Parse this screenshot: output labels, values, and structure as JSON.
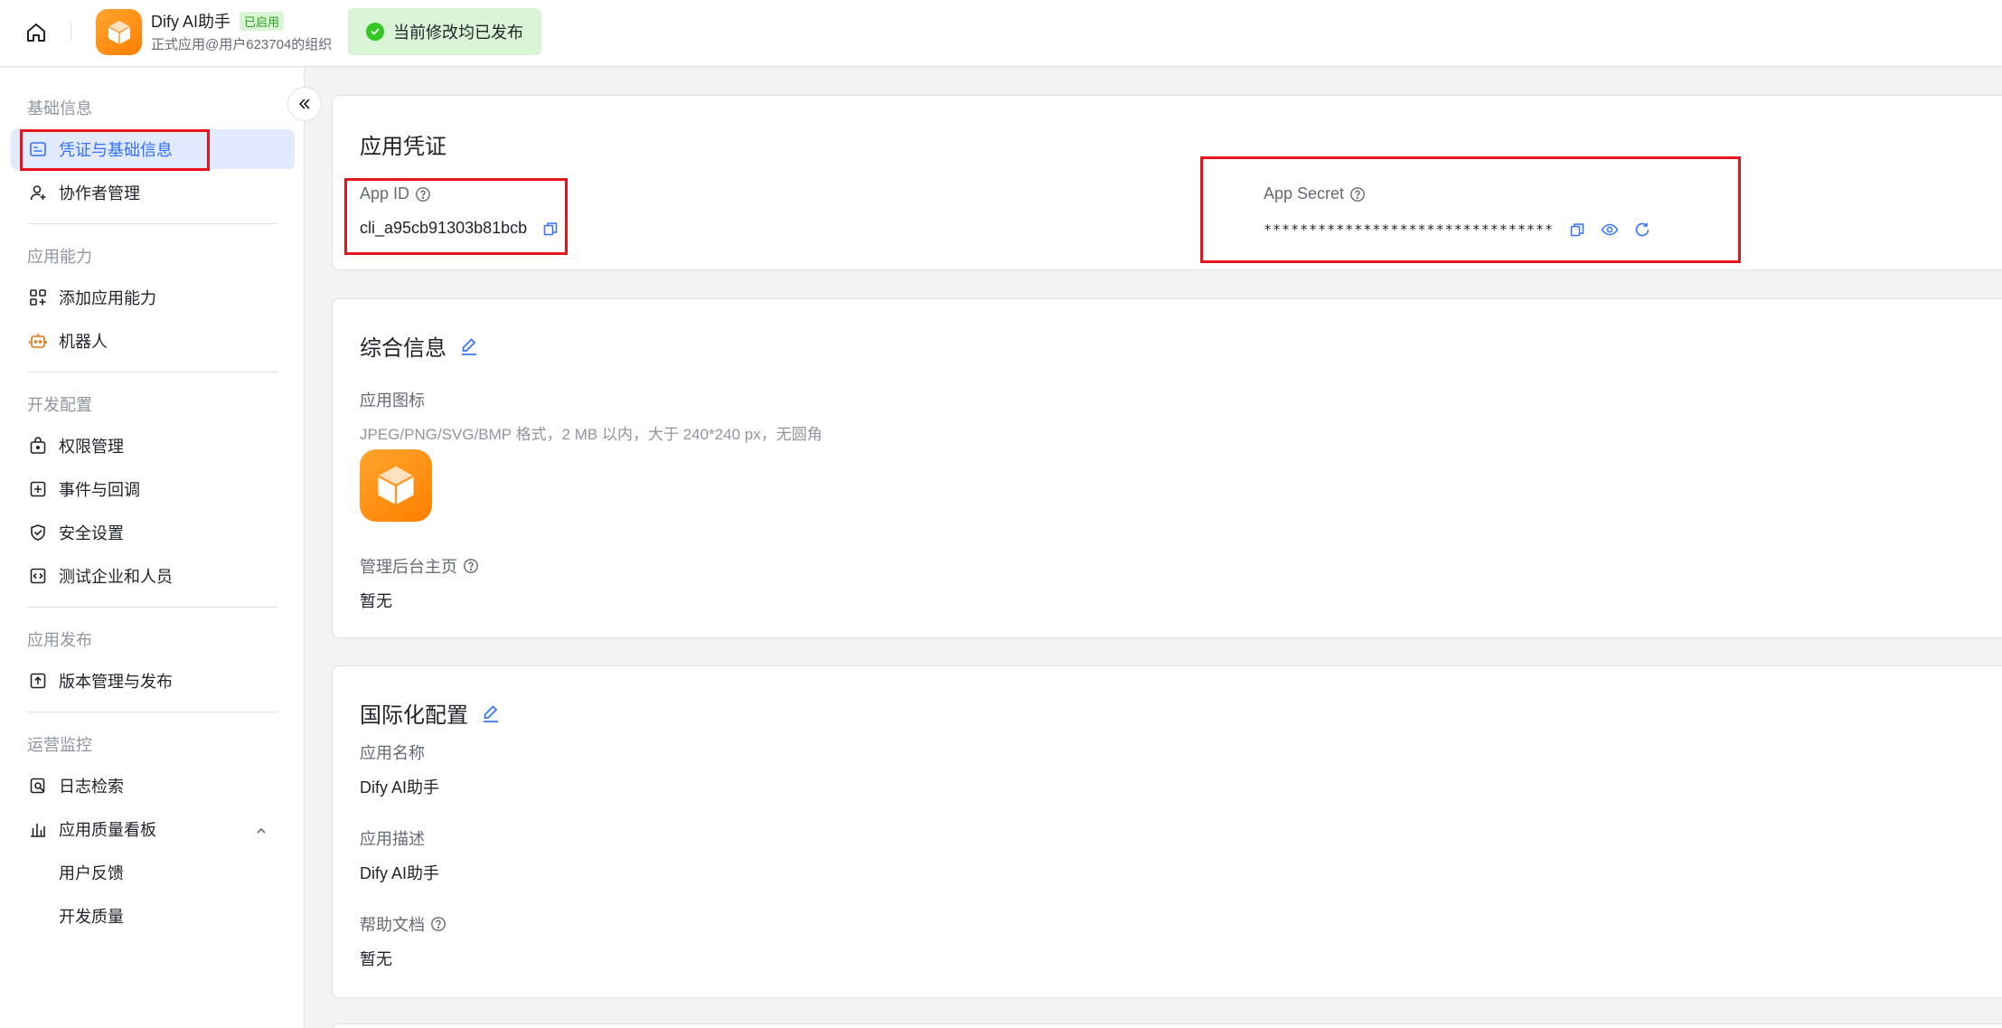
{
  "header": {
    "app_name": "Dify AI助手",
    "status_badge": "已启用",
    "org": "正式应用@用户623704的组织",
    "publish_status": "当前修改均已发布",
    "icons": [
      "home-icon",
      "app-logo-cube-icon",
      "check-circle-icon"
    ]
  },
  "sidebar": {
    "sections": [
      {
        "title": "基础信息",
        "items": [
          {
            "label": "凭证与基础信息",
            "icon": "credential-icon",
            "active": true
          },
          {
            "label": "协作者管理",
            "icon": "user-add-icon"
          }
        ]
      },
      {
        "title": "应用能力",
        "items": [
          {
            "label": "添加应用能力",
            "icon": "apps-add-icon"
          },
          {
            "label": "机器人",
            "icon": "robot-icon"
          }
        ]
      },
      {
        "title": "开发配置",
        "items": [
          {
            "label": "权限管理",
            "icon": "permission-icon"
          },
          {
            "label": "事件与回调",
            "icon": "event-icon"
          },
          {
            "label": "安全设置",
            "icon": "shield-icon"
          },
          {
            "label": "测试企业和人员",
            "icon": "code-icon"
          }
        ]
      },
      {
        "title": "应用发布",
        "items": [
          {
            "label": "版本管理与发布",
            "icon": "upload-icon"
          }
        ]
      },
      {
        "title": "运营监控",
        "items": [
          {
            "label": "日志检索",
            "icon": "log-search-icon"
          },
          {
            "label": "应用质量看板",
            "icon": "bar-chart-icon",
            "expanded": true
          },
          {
            "label": "用户反馈"
          },
          {
            "label": "开发质量"
          }
        ]
      }
    ]
  },
  "credentials": {
    "title": "应用凭证",
    "app_id_label": "App ID",
    "app_id_value": "cli_a95cb91303b81bcb",
    "app_secret_label": "App Secret",
    "app_secret_value": "********************************"
  },
  "general": {
    "title": "综合信息",
    "icon_label": "应用图标",
    "icon_hint": "JPEG/PNG/SVG/BMP 格式，2 MB 以内，大于 240*240 px，无圆角",
    "homepage_label": "管理后台主页",
    "homepage_value": "暂无"
  },
  "i18n": {
    "title": "国际化配置",
    "name_label": "应用名称",
    "name_value": "Dify AI助手",
    "desc_label": "应用描述",
    "desc_value": "Dify AI助手",
    "help_label": "帮助文档",
    "help_value": "暂无"
  },
  "colors": {
    "accent": "#3370ff",
    "active_bg": "#e1eaff",
    "success": "#34c724",
    "logo_orange": "#ff8c1a",
    "annotation_red": "#e8141b"
  }
}
